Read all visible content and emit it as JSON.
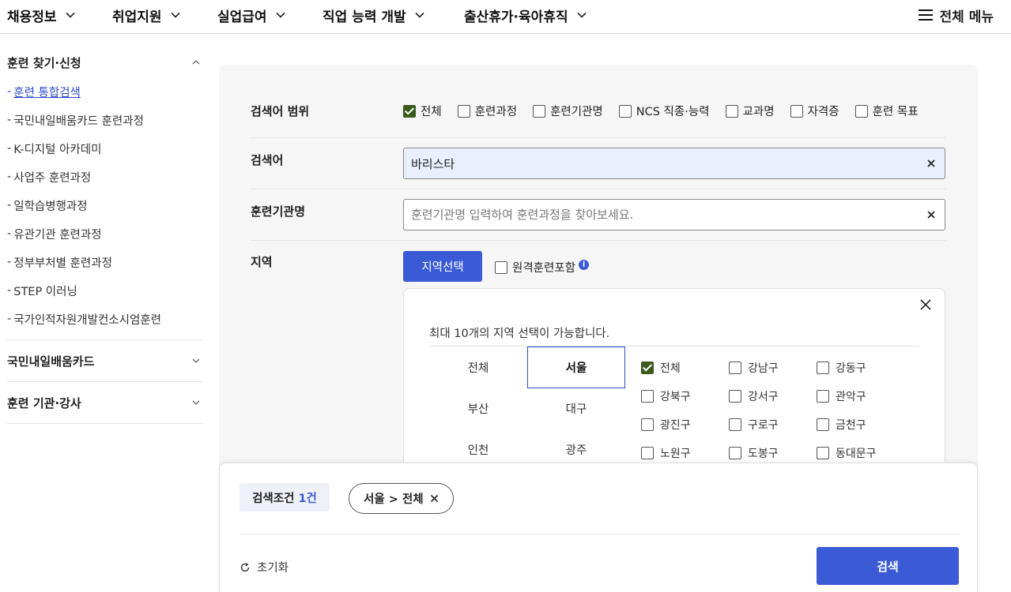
{
  "topnav": {
    "items": [
      "채용정보",
      "취업지원",
      "실업급여",
      "직업 능력 개발",
      "출산휴가·육아휴직"
    ],
    "all_menu": "전체 메뉴"
  },
  "sidebar": {
    "group1_title": "훈련 찾기·신청",
    "items": [
      "훈련 통합검색",
      "국민내일배움카드 훈련과정",
      "K-디지털 아카데미",
      "사업주 훈련과정",
      "일학습병행과정",
      "유관기관 훈련과정",
      "정부부처별 훈련과정",
      "STEP 이러닝",
      "국가인적자원개발컨소시엄훈련"
    ],
    "dash": "-",
    "group2_title": "국민내일배움카드",
    "group3_title": "훈련 기관·강사"
  },
  "scope": {
    "label": "검색어 범위",
    "options": [
      "전체",
      "훈련과정",
      "훈련기관명",
      "NCS 직종·능력",
      "교과명",
      "자격증",
      "훈련 목표"
    ],
    "checked": [
      true,
      false,
      false,
      false,
      false,
      false,
      false
    ]
  },
  "keyword": {
    "label": "검색어",
    "value": "바리스타"
  },
  "institution": {
    "label": "훈련기관명",
    "placeholder": "훈련기관명 입력하여 훈련과정을 찾아보세요."
  },
  "region": {
    "label": "지역",
    "button": "지역선택",
    "remote_label": "원격훈련포함",
    "info": "i",
    "popup": {
      "message": "최대 10개의 지역 선택이 가능합니다.",
      "cities": [
        "전체",
        "서울",
        "부산",
        "대구",
        "인천",
        "광주"
      ],
      "selected_city": "서울",
      "districts": [
        "전체",
        "강남구",
        "강동구",
        "강북구",
        "강서구",
        "관악구",
        "광진구",
        "구로구",
        "금천구",
        "노원구",
        "도봉구",
        "동대문구"
      ],
      "checked_district": "전체"
    }
  },
  "bottom": {
    "cond_label": "검색조건",
    "cond_count": "1건",
    "chip": "서울 > 전체",
    "reset": "초기화",
    "search": "검색"
  },
  "colors": {
    "accent": "#3b5bd6",
    "checked": "#3a5a1c"
  }
}
